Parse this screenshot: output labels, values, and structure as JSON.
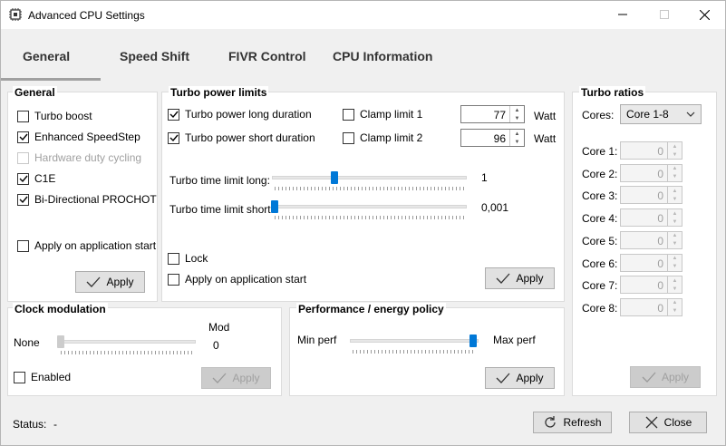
{
  "window": {
    "title": "Advanced CPU Settings"
  },
  "tabs": [
    {
      "label": "General"
    },
    {
      "label": "Speed Shift"
    },
    {
      "label": "FIVR Control"
    },
    {
      "label": "CPU Information"
    }
  ],
  "general": {
    "title": "General",
    "turbo_boost": "Turbo boost",
    "enhanced_speedstep": "Enhanced SpeedStep",
    "hardware_duty_cycling": "Hardware duty cycling",
    "c1e": "C1E",
    "bidirectional_prochot": "Bi-Directional PROCHOT",
    "apply_on_start": "Apply on application start",
    "apply_label": "Apply"
  },
  "turbo_power": {
    "title": "Turbo power limits",
    "long_duration": "Turbo power long duration",
    "short_duration": "Turbo power short duration",
    "clamp1": "Clamp limit 1",
    "clamp2": "Clamp limit 2",
    "long_value": "77",
    "short_value": "96",
    "unit_watt1": "Watt",
    "unit_watt2": "Watt",
    "time_long_label": "Turbo time limit long:",
    "time_short_label": "Turbo time limit short:",
    "time_long_value": "1",
    "time_short_value": "0,001",
    "lock": "Lock",
    "apply_on_start": "Apply on application start",
    "apply_label": "Apply"
  },
  "turbo_ratios": {
    "title": "Turbo ratios",
    "cores_label": "Cores:",
    "cores_selected": "Core 1-8",
    "cores": [
      {
        "label": "Core 1:",
        "value": "0"
      },
      {
        "label": "Core 2:",
        "value": "0"
      },
      {
        "label": "Core 3:",
        "value": "0"
      },
      {
        "label": "Core 4:",
        "value": "0"
      },
      {
        "label": "Core 5:",
        "value": "0"
      },
      {
        "label": "Core 6:",
        "value": "0"
      },
      {
        "label": "Core 7:",
        "value": "0"
      },
      {
        "label": "Core 8:",
        "value": "0"
      }
    ],
    "apply_label": "Apply"
  },
  "clock_modulation": {
    "title": "Clock modulation",
    "none_label": "None",
    "mod_label": "Mod",
    "value": "0",
    "enabled": "Enabled",
    "apply_label": "Apply"
  },
  "perf_policy": {
    "title": "Performance / energy policy",
    "min_label": "Min perf",
    "max_label": "Max perf",
    "apply_label": "Apply"
  },
  "status": {
    "label": "Status:",
    "value": "-"
  },
  "footer": {
    "refresh_label": "Refresh",
    "close_label": "Close"
  },
  "colors": {
    "accent": "#0078d7",
    "tab_bg": "#f0f0f0"
  }
}
